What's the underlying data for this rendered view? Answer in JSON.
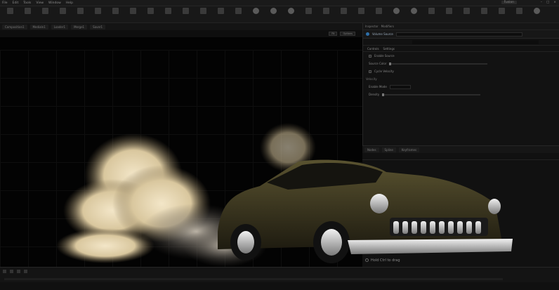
{
  "menubar": {
    "items": [
      "File",
      "Edit",
      "Tools",
      "View",
      "Window",
      "Help"
    ],
    "workspace_tabs": [
      "Fusion"
    ]
  },
  "tabs": [
    "Composition1",
    "MediaIn1",
    "Loader1",
    "Merge1",
    "Saver1"
  ],
  "viewer": {
    "buttons": [
      "Fit",
      "Options"
    ]
  },
  "inspector": {
    "tabs": [
      "Inspector",
      "Modifiers"
    ],
    "node_title": "Volume Source",
    "sub_tabs": [
      "Controls",
      "Settings"
    ],
    "rows": [
      "Enable Source",
      "Source Color",
      "Cycle Velocity",
      "Velocity",
      "Enable Mode",
      "Density"
    ]
  },
  "graph": {
    "tabs": [
      "Nodes",
      "Spline",
      "Keyframes"
    ]
  },
  "tip": {
    "text": "Hold Ctrl to drag"
  },
  "scene": {
    "car_body": "#3f3a22",
    "smoke": "#e8dcc4"
  }
}
